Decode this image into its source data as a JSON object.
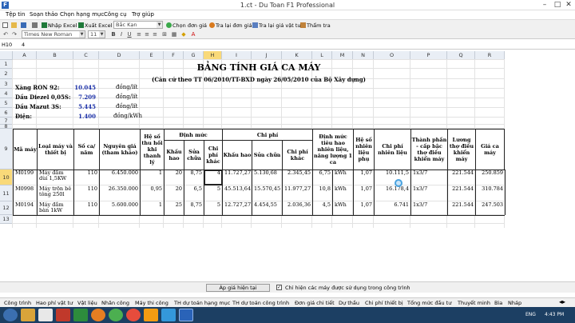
{
  "window": {
    "icon_letter": "F",
    "title": "1.ct - Du Toan F1 Professional",
    "min": "–",
    "max": "□",
    "close": "✕"
  },
  "menu": [
    "Tệp tin",
    "Soạn thảo",
    "Chọn hạng mục",
    "Công cụ",
    "Trợ giúp"
  ],
  "toolbar": {
    "import_excel": "Nhập Excel",
    "export_excel": "Xuất Excel",
    "region": "Bắc Kạn",
    "choose_price": "Chọn đơn giá",
    "lookup_price": "Tra lại đơn giá",
    "lookup_material": "Tra lại giá vật tư",
    "appraise": "Thẩm tra"
  },
  "format": {
    "font": "Times New Roman",
    "size": "11"
  },
  "formula": {
    "cell": "H10",
    "value": "4"
  },
  "grid": {
    "columns": [
      "A",
      "B",
      "C",
      "D",
      "E",
      "F",
      "G",
      "H",
      "I",
      "J",
      "K",
      "L",
      "M",
      "N",
      "O",
      "P",
      "Q",
      "R"
    ],
    "rows": [
      "1",
      "2",
      "3",
      "4",
      "5",
      "6",
      "7",
      "8",
      "9",
      "10",
      "11",
      "12",
      "13"
    ],
    "selected_col": "H",
    "selected_row": "10"
  },
  "sheet": {
    "title": "BẢNG TÍNH GIÁ CA MÁY",
    "subtitle": "(Căn cứ theo TT 06/2010/TT-BXD ngày 26/05/2010 của Bộ Xây dựng)",
    "fuels": [
      {
        "name": "Xăng RON 92:",
        "value": "10.045",
        "unit": "đồng/lít"
      },
      {
        "name": "Dầu Diezel 0,05S:",
        "value": "7.209",
        "unit": "đồng/lít"
      },
      {
        "name": "Dầu Mazut 3S:",
        "value": "5.445",
        "unit": "đồng/lít"
      },
      {
        "name": "Điện:",
        "value": "1.400",
        "unit": "đồng/kWh"
      }
    ],
    "headers": {
      "ma_may": "Mã máy",
      "loai_may": "Loại máy và thiết bị",
      "so_ca": "Số ca/ năm",
      "nguyen_gia": "Nguyên giá (tham khảo)",
      "he_so_thu_hoi": "Hệ số thu hồi khi thanh lý",
      "dinh_muc": "Định mức",
      "khau_hao": "Khấu hao",
      "sua_chua": "Sửa chữa",
      "chi_phi_khac": "Chi phí khác",
      "chi_phi": "Chi phí",
      "khau_hao2": "Khấu hao",
      "sua_chua2": "Sửa chữa",
      "chi_phi_khac2": "Chi phí khác",
      "dinh_muc_nl": "Định mức tiêu hao nhiên liệu, năng lượng 1 ca",
      "he_so_nl_phu": "Hệ số nhiên liệu phụ",
      "chi_phi_nl": "Chi phí nhiên liệu",
      "thanh_phan": "Thành phần - cấp bậc thợ điều khiển máy",
      "luong_tho": "Lương thợ điều khiển máy",
      "gia_ca_may": "Giá ca máy"
    },
    "rows": [
      {
        "ma": "M0199",
        "loai": "Máy đầm dùi 1,5KW",
        "so_ca": "110",
        "nguyen_gia": "6.450.000",
        "he_so": "1",
        "kh": "20",
        "sc": "8,75",
        "cpk": "4",
        "cp_kh": "11.727,27",
        "cp_sc": "5.130,68",
        "cp_k": "2.345,45",
        "dm_nl": "6,75",
        "dv": "kWh",
        "hs_phu": "1,07",
        "cp_nl": "10.111,5",
        "tp": "1x3/7",
        "luong": "221.544",
        "gia": "250.859"
      },
      {
        "ma": "M0998",
        "loai": "Máy trộn bê tông 250l",
        "so_ca": "110",
        "nguyen_gia": "26.350.000",
        "he_so": "0,95",
        "kh": "20",
        "sc": "6,5",
        "cpk": "5",
        "cp_kh": "45.513,64",
        "cp_sc": "15.570,45",
        "cp_k": "11.977,27",
        "dm_nl": "10,8",
        "dv": "kWh",
        "hs_phu": "1,07",
        "cp_nl": "16.178,4",
        "tp": "1x3/7",
        "luong": "221.544",
        "gia": "310.784"
      },
      {
        "ma": "M0194",
        "loai": "Máy đầm bàn 1kW",
        "so_ca": "110",
        "nguyen_gia": "5.600.000",
        "he_so": "1",
        "kh": "25",
        "sc": "8,75",
        "cpk": "5",
        "cp_kh": "12.727,27",
        "cp_sc": "4.454,55",
        "cp_k": "2.036,36",
        "dm_nl": "4,5",
        "dv": "kWh",
        "hs_phu": "1,07",
        "cp_nl": "6.741",
        "tp": "1x3/7",
        "luong": "221.544",
        "gia": "247.503"
      }
    ]
  },
  "status": {
    "apply_button": "Áp giá hiện tại",
    "checkbox_label": "Chỉ hiện các máy được sử dụng trong công trình"
  },
  "sheet_tabs": [
    "Công trình",
    "Hao phí vật tư",
    "Vật liệu",
    "Nhân công",
    "Máy thi công",
    "TH dự toán hạng mục",
    "TH dự toán công trình",
    "Đơn giá chi tiết",
    "Dự thầu",
    "Chi phí thiết bị",
    "Tổng mức đầu tư",
    "Thuyết minh",
    "Bìa",
    "Nháp"
  ],
  "taskbar": {
    "lang": "ENG",
    "time": "4:43 PM"
  }
}
